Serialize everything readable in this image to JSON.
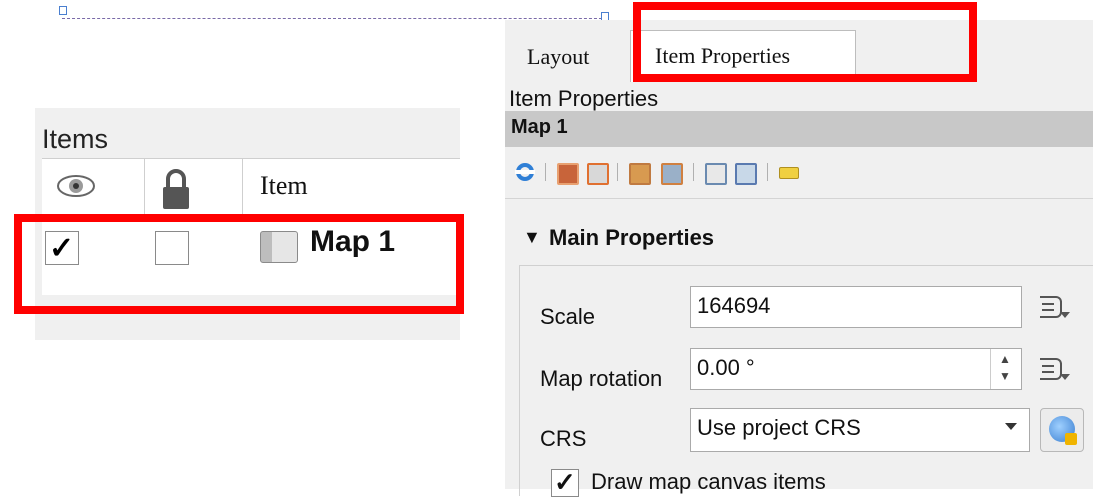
{
  "items_panel": {
    "title": "Items",
    "column_item": "Item",
    "rows": [
      {
        "visible": "✓",
        "locked": false,
        "label": "Map 1"
      }
    ]
  },
  "dock": {
    "tabs": [
      {
        "label": "Layout"
      },
      {
        "label": "Item Properties"
      }
    ],
    "panel_title": "Item Properties",
    "item_name": "Map 1",
    "section": {
      "toggle": "▼",
      "title": "Main Properties"
    },
    "scale": {
      "label": "Scale",
      "value": "164694"
    },
    "map_rotation": {
      "label": "Map rotation",
      "value": "0.00 °",
      "spin_up": "▲",
      "spin_down": "▼"
    },
    "crs": {
      "label": "CRS",
      "value": "Use project CRS"
    },
    "draw_canvas_items": {
      "label": "Draw map canvas items",
      "check": "✓"
    }
  },
  "colors": {
    "highlight": "#ff0000",
    "panel_bg": "#f0f0f0",
    "item_bar": "#c8c8c8"
  }
}
